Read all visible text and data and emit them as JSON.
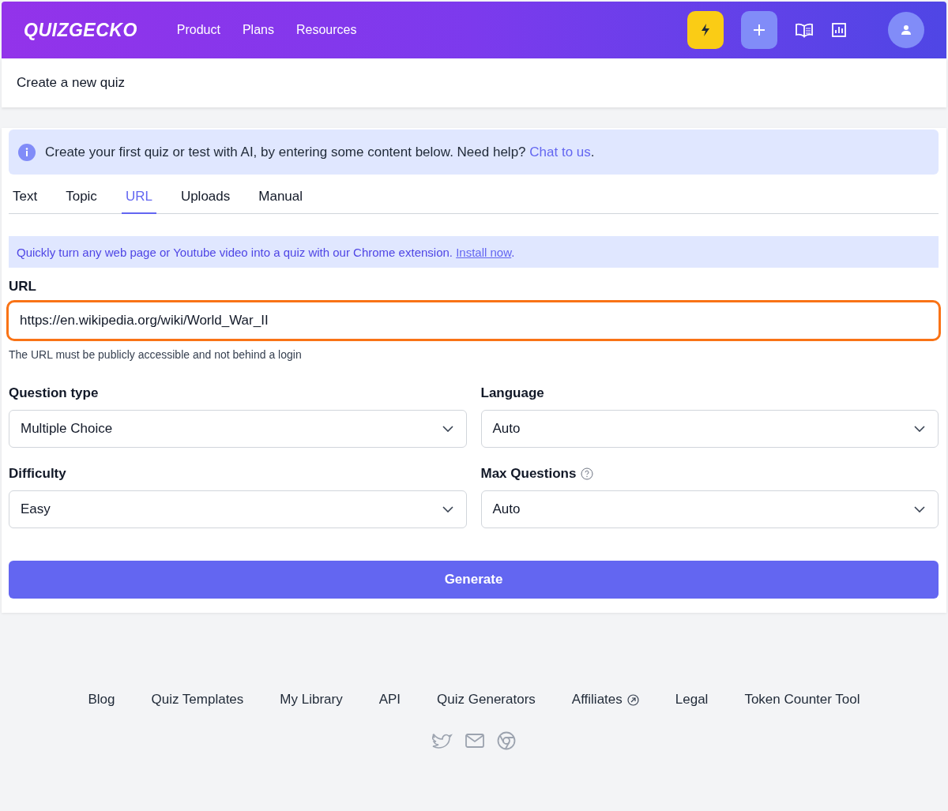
{
  "header": {
    "logo": "QUIZGECKO",
    "nav": [
      "Product",
      "Plans",
      "Resources"
    ]
  },
  "page_title": "Create a new quiz",
  "info": {
    "text": "Create your first quiz or test with AI, by entering some content below. Need help?",
    "link": "Chat to us",
    "end": "."
  },
  "tabs": [
    {
      "label": "Text",
      "selected": false
    },
    {
      "label": "Topic",
      "selected": false
    },
    {
      "label": "URL",
      "selected": true
    },
    {
      "label": "Uploads",
      "selected": false
    },
    {
      "label": "Manual",
      "selected": false
    }
  ],
  "notice": {
    "text": "Quickly turn any web page or Youtube video into a quiz with our Chrome extension.",
    "link": "Install now",
    "end": "."
  },
  "url_field": {
    "label": "URL",
    "value": "https://en.wikipedia.org/wiki/World_War_II",
    "focused": true,
    "hint": "The URL must be publicly accessible and not behind a login"
  },
  "selects": [
    {
      "label": "Question type",
      "value": "Multiple Choice",
      "help": false
    },
    {
      "label": "Language",
      "value": "Auto",
      "help": false
    },
    {
      "label": "Difficulty",
      "value": "Easy",
      "help": false
    },
    {
      "label": "Max Questions",
      "value": "Auto",
      "help": true
    }
  ],
  "generate_button": "Generate",
  "footer_links": [
    {
      "label": "Blog",
      "external": false
    },
    {
      "label": "Quiz Templates",
      "external": false
    },
    {
      "label": "My Library",
      "external": false
    },
    {
      "label": "API",
      "external": false
    },
    {
      "label": "Quiz Generators",
      "external": false
    },
    {
      "label": "Affiliates",
      "external": true
    },
    {
      "label": "Legal",
      "external": false
    },
    {
      "label": "Token Counter Tool",
      "external": false
    }
  ]
}
